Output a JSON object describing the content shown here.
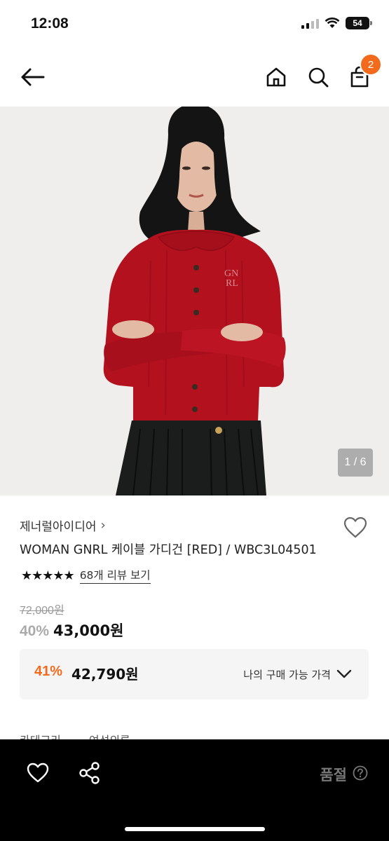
{
  "status": {
    "time": "12:08",
    "battery": "54"
  },
  "nav": {
    "cart_count": "2"
  },
  "image": {
    "counter": "1 / 6"
  },
  "product": {
    "brand": "제너럴아이디어",
    "brand_chevron": "›",
    "title": "WOMAN GNRL 케이블 가디건 [RED] / WBC3L04501",
    "stars": "★★★★★",
    "review_link": "68개 리뷰 보기",
    "original_price": "72,000원",
    "discount": "40%",
    "price": "43,000원",
    "my_discount": "41%",
    "my_price": "42,790원",
    "my_price_label": "나의 구매 가능 가격",
    "peek_labels": [
      "카테고리",
      "여성의류"
    ]
  },
  "bottom": {
    "soldout_label": "품절"
  },
  "colors": {
    "accent": "#f26b1d",
    "sweater": "#b3111e"
  }
}
